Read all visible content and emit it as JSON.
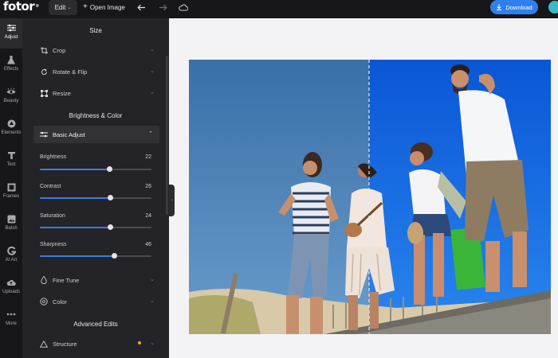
{
  "topbar": {
    "logo": "fotor",
    "logo_mark": "®",
    "edit_label": "Edit",
    "open_image_label": "Open Image",
    "download_label": "Download"
  },
  "leftnav": {
    "items": [
      {
        "label": "Adjust",
        "icon": "sliders-icon",
        "active": true
      },
      {
        "label": "Effects",
        "icon": "flask-icon",
        "active": false
      },
      {
        "label": "Beauty",
        "icon": "eye-icon",
        "active": false
      },
      {
        "label": "Elements",
        "icon": "shapes-icon",
        "active": false
      },
      {
        "label": "Text",
        "icon": "text-icon",
        "active": false
      },
      {
        "label": "Frames",
        "icon": "frame-icon",
        "active": false
      },
      {
        "label": "Batch",
        "icon": "batch-icon",
        "active": false
      },
      {
        "label": "AI Art",
        "icon": "ai-art-icon",
        "active": false
      },
      {
        "label": "Uploads",
        "icon": "cloud-upload-icon",
        "active": false
      },
      {
        "label": "More",
        "icon": "more-icon",
        "active": false
      }
    ]
  },
  "panel": {
    "size_title": "Size",
    "size_tools": [
      {
        "label": "Crop",
        "icon": "crop-icon"
      },
      {
        "label": "Rotate & Flip",
        "icon": "rotate-icon"
      },
      {
        "label": "Resize",
        "icon": "resize-icon"
      }
    ],
    "brightness_title": "Brightness & Color",
    "basic_adjust_label": "Basic Adjust",
    "sliders": [
      {
        "label": "Brightness",
        "value": 22,
        "fraction": 0.62
      },
      {
        "label": "Contrast",
        "value": 26,
        "fraction": 0.63
      },
      {
        "label": "Saturation",
        "value": 24,
        "fraction": 0.625
      },
      {
        "label": "Sharpness",
        "value": 46,
        "fraction": 0.665
      }
    ],
    "color_tools": [
      {
        "label": "Fine Tune",
        "icon": "droplet-icon"
      },
      {
        "label": "Color",
        "icon": "palette-icon"
      }
    ],
    "advanced_title": "Advanced Edits",
    "advanced_tools": [
      {
        "label": "Structure",
        "icon": "triangle-icon"
      }
    ]
  },
  "colors": {
    "accent": "#2f80ed",
    "panel_bg": "#242428",
    "sidebar_bg": "#17171a",
    "canvas_bg": "#f3f3f5",
    "badge": "#f5a623"
  }
}
